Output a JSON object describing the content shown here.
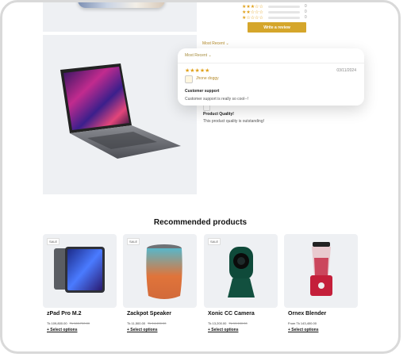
{
  "reviews": {
    "rating_rows": [
      {
        "stars": "★★★☆☆",
        "count": "0"
      },
      {
        "stars": "★★☆☆☆",
        "count": "0"
      },
      {
        "stars": "★☆☆☆☆",
        "count": "0"
      }
    ],
    "write_review_label": "Write a review",
    "background_sort_label": "Most Recent ⌄",
    "popup": {
      "sort_label": "Most Recent ⌄",
      "stars": "★★★★★",
      "date": "03/11/2024",
      "reviewer": "Jhone doggy",
      "title": "Customer support",
      "body": "Customer support is really so cool--!"
    },
    "background_review": {
      "title": "Product Quality!",
      "body": "This product quality is outstanding!"
    }
  },
  "recommended": {
    "title": "Recommended products",
    "products": [
      {
        "sale": "SALE",
        "name": "zPad Pro M.2",
        "price": "Tk 109,800.00",
        "old_price": "Tk 160,700.00",
        "options": "+ Select options"
      },
      {
        "sale": "SALE",
        "name": "Zackpot Speaker",
        "price": "Tk 11,500.00",
        "old_price": "Tk 14,400.00",
        "options": "+ Select options"
      },
      {
        "sale": "SALE",
        "name": "Xonic CC Camera",
        "price": "Tk 13,200.00",
        "old_price": "Tk 19,100.00",
        "options": "+ Select options"
      },
      {
        "sale": "",
        "name": "Ornex Blender",
        "price": "From Tk 143,400.00",
        "old_price": "",
        "options": "+ Select options"
      }
    ]
  },
  "colors": {
    "accent": "#d5a62b",
    "star": "#e0a11b",
    "panel": "#eef0f3"
  },
  "icons": {
    "avatar": "user-avatar-icon",
    "laptop": "laptop-image",
    "phone": "phone-image"
  }
}
